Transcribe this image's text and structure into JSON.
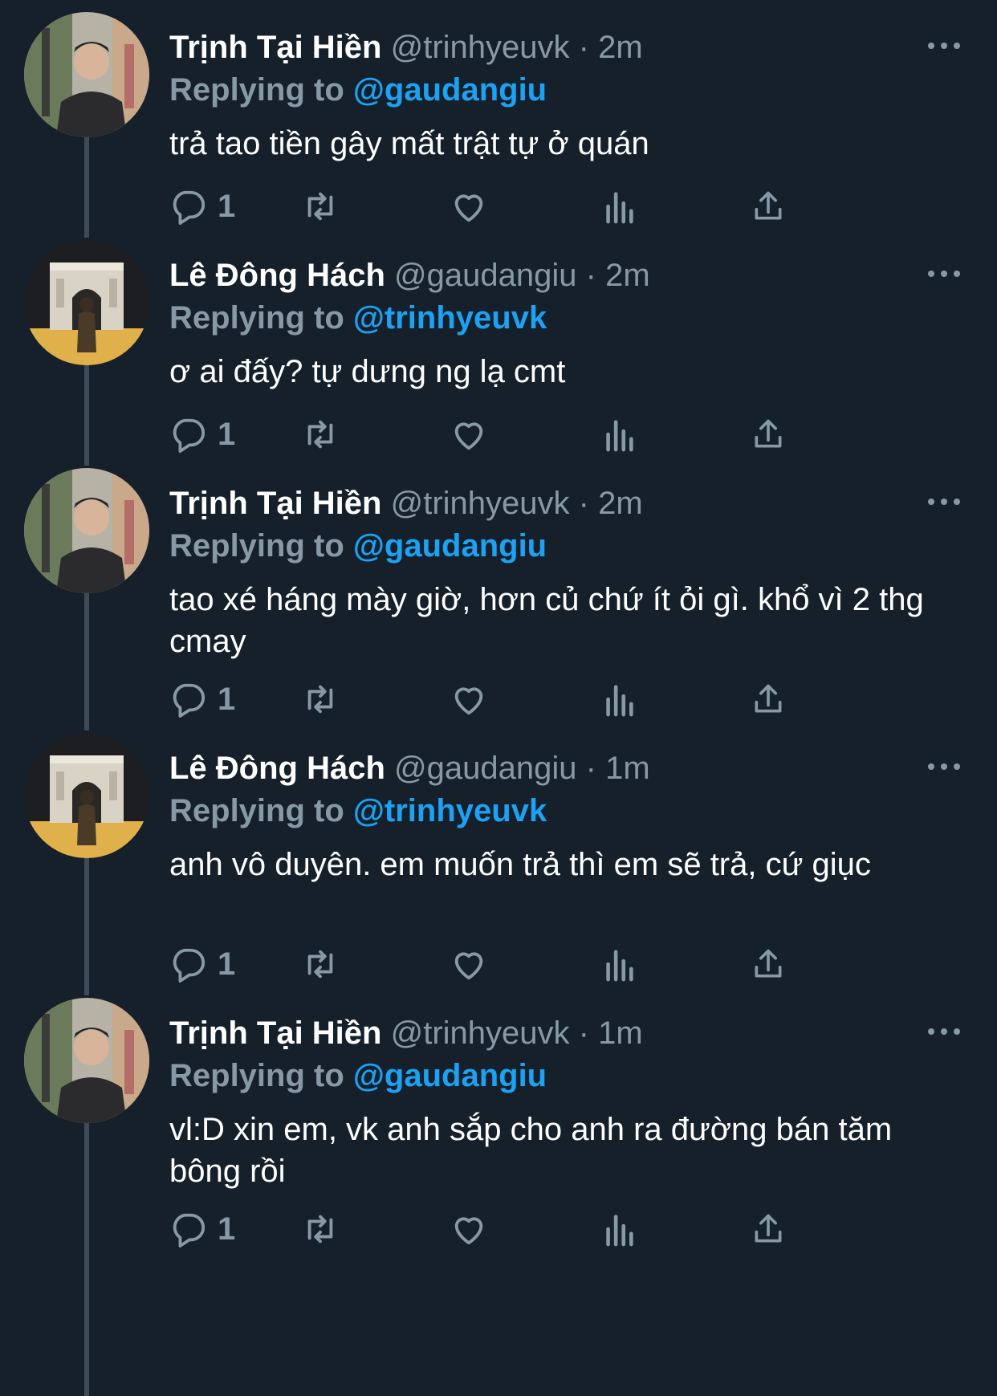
{
  "colors": {
    "background": "#15202b",
    "secondary_text": "#8899a6",
    "link": "#1da1f2",
    "thread_line": "#3d4b59"
  },
  "reply_prefix": "Replying to",
  "tweets": [
    {
      "name": "Trịnh Tại Hiền",
      "handle": "@trinhyeuvk",
      "dot": "·",
      "time": "2m",
      "replying_to": "@gaudangiu",
      "text": "trả tao tiền gây mất trật tự ở quán",
      "reply_count": "1",
      "avatar": "man-portrait-avatar"
    },
    {
      "name": "Lê Đông Hách",
      "handle": "@gaudangiu",
      "dot": "·",
      "time": "2m",
      "replying_to": "@trinhyeuvk",
      "text": "ơ ai đấy? tự dưng ng lạ cmt",
      "reply_count": "1",
      "avatar": "arc-de-triomphe-avatar"
    },
    {
      "name": "Trịnh Tại Hiền",
      "handle": "@trinhyeuvk",
      "dot": "·",
      "time": "2m",
      "replying_to": "@gaudangiu",
      "text": "tao xé háng mày giờ, hơn củ chứ ít ỏi gì. khổ vì 2 thg cmay",
      "reply_count": "1",
      "avatar": "man-portrait-avatar"
    },
    {
      "name": "Lê Đông Hách",
      "handle": "@gaudangiu",
      "dot": "·",
      "time": "1m",
      "replying_to": "@trinhyeuvk",
      "text": "anh vô duyên. em muốn trả thì em sẽ trả, cứ giục",
      "reply_count": "1",
      "avatar": "arc-de-triomphe-avatar"
    },
    {
      "name": "Trịnh Tại Hiền",
      "handle": "@trinhyeuvk",
      "dot": "·",
      "time": "1m",
      "replying_to": "@gaudangiu",
      "text": "vl:D xin em, vk anh sắp cho anh ra đường bán tăm bông rồi",
      "reply_count": "1",
      "avatar": "man-portrait-avatar"
    }
  ]
}
